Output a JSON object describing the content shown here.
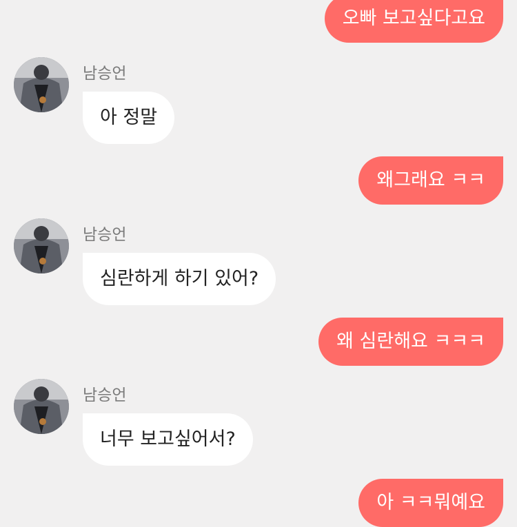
{
  "colors": {
    "background": "#f1f0f0",
    "outgoing_bubble": "#ff6b67",
    "incoming_bubble": "#ffffff",
    "sender_name": "#7a7a7a"
  },
  "messages": [
    {
      "direction": "outgoing",
      "text": "오빠 보고싶다고요"
    },
    {
      "direction": "incoming",
      "sender": "남승언",
      "avatar": "profile-photo",
      "text": "아 정말"
    },
    {
      "direction": "outgoing",
      "text": "왜그래요 ㅋㅋ"
    },
    {
      "direction": "incoming",
      "sender": "남승언",
      "avatar": "profile-photo",
      "text": "심란하게 하기 있어?"
    },
    {
      "direction": "outgoing",
      "text": "왜 심란해요 ㅋㅋㅋ"
    },
    {
      "direction": "incoming",
      "sender": "남승언",
      "avatar": "profile-photo",
      "text": "너무 보고싶어서?"
    },
    {
      "direction": "outgoing",
      "text": "아 ㅋㅋ뭐예요"
    }
  ]
}
